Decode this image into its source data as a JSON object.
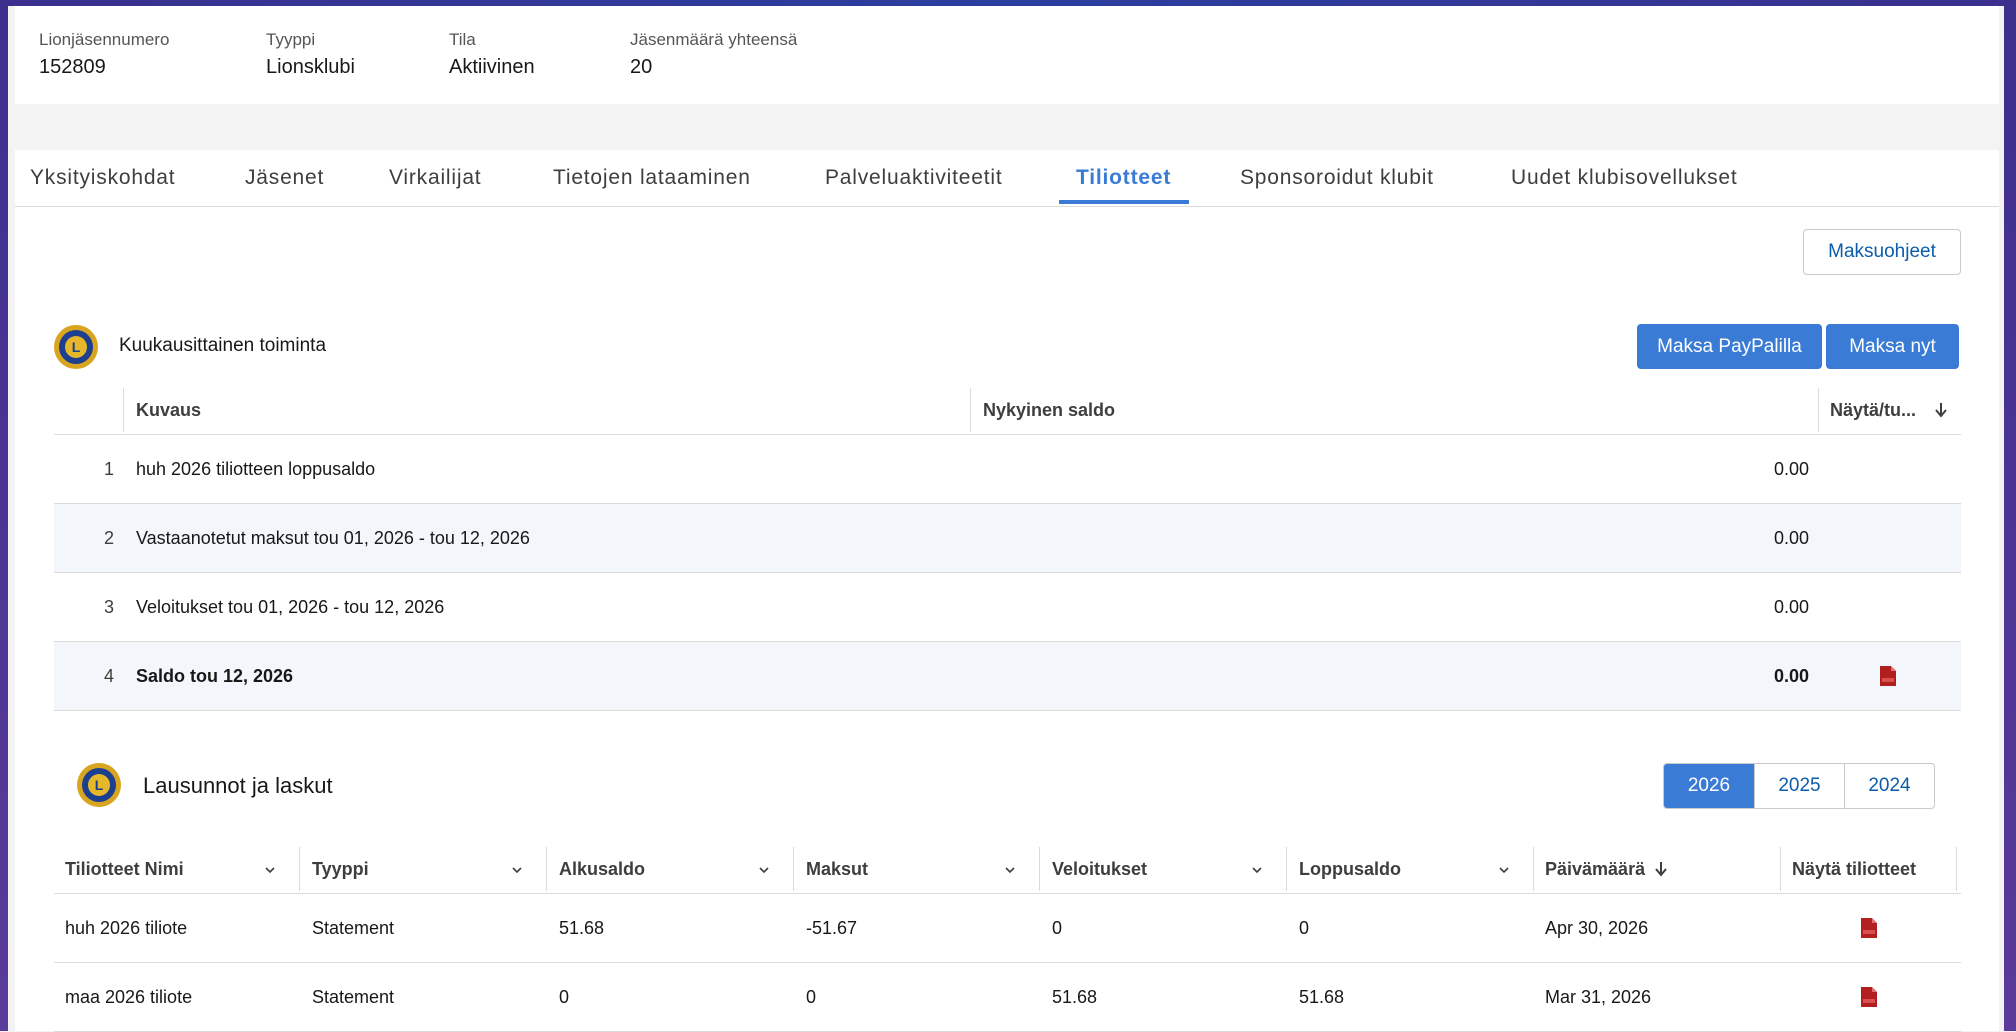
{
  "header": {
    "fields": [
      {
        "label": "Lionjäsennumero",
        "value": "152809"
      },
      {
        "label": "Tyyppi",
        "value": "Lionsklubi"
      },
      {
        "label": "Tila",
        "value": "Aktiivinen"
      },
      {
        "label": "Jäsenmäärä yhteensä",
        "value": "20"
      }
    ]
  },
  "tabs": [
    {
      "label": "Yksityiskohdat"
    },
    {
      "label": "Jäsenet"
    },
    {
      "label": "Virkailijat"
    },
    {
      "label": "Tietojen lataaminen"
    },
    {
      "label": "Palveluaktiviteetit"
    },
    {
      "label": "Tiliotteet",
      "active": true
    },
    {
      "label": "Sponsoroidut klubit"
    },
    {
      "label": "Uudet klubisovellukset"
    }
  ],
  "payment_instructions_label": "Maksuohjeet",
  "monthly": {
    "title": "Kuukausittainen toiminta",
    "pay_paypal_label": "Maksa PayPalilla",
    "pay_now_label": "Maksa nyt",
    "columns": {
      "description": "Kuvaus",
      "balance": "Nykyinen saldo",
      "view": "Näytä/tu..."
    },
    "rows": [
      {
        "num": "1",
        "description": "huh 2026 tiliotteen loppusaldo",
        "amount": "0.00"
      },
      {
        "num": "2",
        "description": "Vastaanotetut maksut tou 01, 2026 - tou 12, 2026",
        "amount": "0.00"
      },
      {
        "num": "3",
        "description": "Veloitukset tou 01, 2026 - tou 12, 2026",
        "amount": "0.00"
      },
      {
        "num": "4",
        "description": "Saldo tou 12, 2026",
        "amount": "0.00",
        "has_pdf": true
      }
    ]
  },
  "statements": {
    "title": "Lausunnot ja laskut",
    "years": [
      "2026",
      "2025",
      "2024"
    ],
    "active_year": "2026",
    "columns": [
      "Tiliotteet Nimi",
      "Tyyppi",
      "Alkusaldo",
      "Maksut",
      "Veloitukset",
      "Loppusaldo",
      "Päivämäärä",
      "Näytä tiliotteet"
    ],
    "rows": [
      {
        "name": "huh 2026 tiliote",
        "type": "Statement",
        "opening": "51.68",
        "payments": "-51.67",
        "charges": "0",
        "closing": "0",
        "date": "Apr 30, 2026"
      },
      {
        "name": "maa 2026 tiliote",
        "type": "Statement",
        "opening": "0",
        "payments": "0",
        "charges": "51.68",
        "closing": "51.68",
        "date": "Mar 31, 2026"
      }
    ]
  },
  "icons": {
    "pdf": "pdf-file-icon",
    "logo": "lions-logo-icon",
    "sort": "arrow-down-icon",
    "chevron": "chevron-down-icon"
  },
  "colors": {
    "accent": "#3a7bd5",
    "pdf": "#b11f1f"
  }
}
